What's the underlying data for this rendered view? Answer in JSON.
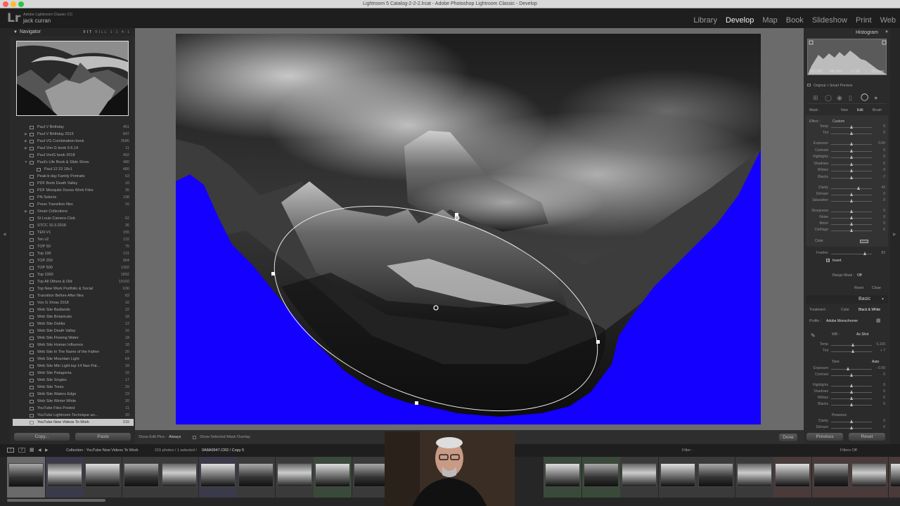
{
  "window": {
    "title": "Lightroom 5 Catalog-2-2-2.lrcat - Adobe Photoshop Lightroom Classic - Develop"
  },
  "identity": {
    "logo": "Lr",
    "app_name": "Adobe Lightroom Classic CC",
    "user": "jack curran"
  },
  "modules": [
    "Library",
    "Develop",
    "Map",
    "Book",
    "Slideshow",
    "Print",
    "Web"
  ],
  "navigator": {
    "title": "Navigator",
    "zoom_options": [
      "FIT",
      "FILL",
      "1:1",
      "4:1"
    ]
  },
  "collections": [
    {
      "name": "Paul V Birthday",
      "count": "451",
      "icon": "collection"
    },
    {
      "name": "Paul V Birthday 2015",
      "count": "847",
      "icon": "collection",
      "expand": "right"
    },
    {
      "name": "Paul VG Combination book",
      "count": "3586",
      "icon": "collection",
      "expand": "right"
    },
    {
      "name": "Paul Von G book 9.6.14",
      "count": "11",
      "icon": "collection",
      "expand": "right"
    },
    {
      "name": "Paul VonG book 2018",
      "count": "402",
      "icon": "collection"
    },
    {
      "name": "Paul's Life Book & Slide Show",
      "count": "480",
      "icon": "collection",
      "expand": "down"
    },
    {
      "name": "Paul 12 23 18v1",
      "count": "480",
      "icon": "book",
      "indent": true
    },
    {
      "name": "Peak-b day Family Portraits",
      "count": "63",
      "icon": "collection"
    },
    {
      "name": "PDF Book Death Valley",
      "count": "16",
      "icon": "collection"
    },
    {
      "name": "PDF Mesquite Dunes Work Files",
      "count": "35",
      "icon": "collection"
    },
    {
      "name": "PN Selects",
      "count": "108",
      "icon": "collection"
    },
    {
      "name": "Press Transition files",
      "count": "16",
      "icon": "collection"
    },
    {
      "name": "Smart Collections",
      "count": "",
      "icon": "folder",
      "expand": "right"
    },
    {
      "name": "St Louis Camera Club",
      "count": "62",
      "icon": "collection"
    },
    {
      "name": "STCC 10.3.2018",
      "count": "36",
      "icon": "collection"
    },
    {
      "name": "TEN V1",
      "count": "155",
      "icon": "collection"
    },
    {
      "name": "Ten v2",
      "count": "132",
      "icon": "collection"
    },
    {
      "name": "TOP 50",
      "count": "75",
      "icon": "collection"
    },
    {
      "name": "Top 100",
      "count": "131",
      "icon": "collection"
    },
    {
      "name": "TOP 250",
      "count": "964",
      "icon": "collection"
    },
    {
      "name": "TOP 500",
      "count": "1302",
      "icon": "collection"
    },
    {
      "name": "Top 1000",
      "count": "1892",
      "icon": "collection"
    },
    {
      "name": "Top All Others & Old",
      "count": "10150",
      "icon": "collection"
    },
    {
      "name": "Top New Work Portfolio & Social",
      "count": "636",
      "icon": "collection"
    },
    {
      "name": "Transition Before After files",
      "count": "83",
      "icon": "collection"
    },
    {
      "name": "Von G Xmas 2018",
      "count": "16",
      "icon": "collection"
    },
    {
      "name": "Web Site Badlands",
      "count": "22",
      "icon": "collection"
    },
    {
      "name": "Web Site Botanicals",
      "count": "18",
      "icon": "collection"
    },
    {
      "name": "Web Site Dahlia",
      "count": "12",
      "icon": "collection"
    },
    {
      "name": "Web Site Death Valley",
      "count": "16",
      "icon": "collection"
    },
    {
      "name": "Web Site Flowing Water",
      "count": "18",
      "icon": "collection"
    },
    {
      "name": "Web Site Human Influence",
      "count": "18",
      "icon": "collection"
    },
    {
      "name": "Web Site In The Name of the Father",
      "count": "20",
      "icon": "collection"
    },
    {
      "name": "Web Site Mountain Light",
      "count": "64",
      "icon": "collection"
    },
    {
      "name": "Web Site Mtn Light top 14 Nan Pat...",
      "count": "18",
      "icon": "collection"
    },
    {
      "name": "Web Site Patagonia",
      "count": "16",
      "icon": "collection"
    },
    {
      "name": "Web Site Singles",
      "count": "17",
      "icon": "collection"
    },
    {
      "name": "Web Site Trees",
      "count": "29",
      "icon": "collection"
    },
    {
      "name": "Web Site Waters Edge",
      "count": "23",
      "icon": "collection"
    },
    {
      "name": "Web Site Winter White",
      "count": "20",
      "icon": "collection"
    },
    {
      "name": "YouTube Files Posted",
      "count": "11",
      "icon": "collection"
    },
    {
      "name": "YouTube Lightroom Technique an...",
      "count": "20",
      "icon": "collection"
    },
    {
      "name": "YouTube New Videos To Work",
      "count": "215",
      "icon": "collection",
      "selected": true
    }
  ],
  "left_buttons": {
    "copy": "Copy...",
    "paste": "Paste"
  },
  "toolbar": {
    "show_edit_pins_label": "Show Edit Pins :",
    "show_edit_pins_value": "Always",
    "show_mask_overlay": "Show Selected Mask Overlay",
    "done": "Done"
  },
  "histogram": {
    "title": "Histogram",
    "iso": "ISO 100",
    "focal": "140 mm",
    "aperture": "ƒ / 16",
    "shutter": "25.0 sec",
    "preview": "Original + Smart Preview"
  },
  "mask": {
    "label": "Mask :",
    "new": "New",
    "edit": "Edit",
    "brush": "Brush"
  },
  "effect": {
    "label": "Effect :",
    "value": "Custom"
  },
  "sliders": [
    {
      "label": "Temp",
      "pos": 0.5,
      "value": "0"
    },
    {
      "label": "Tint",
      "pos": 0.5,
      "value": "0"
    },
    {
      "label": "Exposure",
      "pos": 0.5,
      "value": "0.00"
    },
    {
      "label": "Contrast",
      "pos": 0.5,
      "value": "0"
    },
    {
      "label": "Highlights",
      "pos": 0.5,
      "value": "0"
    },
    {
      "label": "Shadows",
      "pos": 0.5,
      "value": "0"
    },
    {
      "label": "Whites",
      "pos": 0.5,
      "value": "0"
    },
    {
      "label": "Blacks",
      "pos": 0.5,
      "value": "-7"
    },
    {
      "label": "Clarity",
      "pos": 0.68,
      "value": "43"
    },
    {
      "label": "Dehaze",
      "pos": 0.5,
      "value": "0"
    },
    {
      "label": "Saturation",
      "pos": 0.5,
      "value": "0"
    },
    {
      "label": "Sharpness",
      "pos": 0.5,
      "value": "0"
    },
    {
      "label": "Noise",
      "pos": 0.5,
      "value": "0"
    },
    {
      "label": "Moiré",
      "pos": 0.5,
      "value": "0"
    },
    {
      "label": "Defringe",
      "pos": 0.5,
      "value": "0"
    }
  ],
  "color_label": "Color",
  "feather": {
    "label": "Feather",
    "pos": 0.83,
    "value": "83"
  },
  "invert": "Invert",
  "range_mask": {
    "label": "Range Mask :",
    "value": "Off"
  },
  "mask_buttons": {
    "reset": "Reset",
    "close": "Close"
  },
  "basic": {
    "title": "Basic",
    "treatment_label": "Treatment :",
    "treatment_color": "Color",
    "treatment_bw": "Black & White",
    "profile_label": "Profile :",
    "profile_value": "Adobe Monochrome",
    "wb_label": "WB :",
    "wb_value": "As Shot",
    "tone_label": "Tone",
    "tone_auto": "Auto",
    "presence_label": "Presence",
    "sliders": [
      {
        "label": "Temp",
        "pos": 0.55,
        "value": "6,100"
      },
      {
        "label": "Tint",
        "pos": 0.55,
        "value": "+ 7"
      },
      {
        "label": "Exposure",
        "pos": 0.43,
        "value": "- 0.90"
      },
      {
        "label": "Contrast",
        "pos": 0.5,
        "value": "0"
      },
      {
        "label": "Highlights",
        "pos": 0.5,
        "value": "0"
      },
      {
        "label": "Shadows",
        "pos": 0.5,
        "value": "0"
      },
      {
        "label": "Whites",
        "pos": 0.5,
        "value": "0"
      },
      {
        "label": "Blacks",
        "pos": 0.5,
        "value": "0"
      },
      {
        "label": "Clarity",
        "pos": 0.5,
        "value": "0"
      },
      {
        "label": "Dehaze",
        "pos": 0.5,
        "value": "0"
      }
    ]
  },
  "nav_buttons": {
    "previous": "Previous",
    "reset": "Reset"
  },
  "filmstrip_bar": {
    "screens": [
      "1",
      "2"
    ],
    "source": "Collection : YouTube New Videos To Work",
    "count": "215 photos / 1 selected /",
    "file": "0A8A0947.CR2 / Copy 5",
    "filter_label": "Filter :",
    "filter_value": "Filters Off"
  },
  "colors": {
    "mask_overlay": "#1400ff",
    "panel": "#2b2b2b",
    "selected_row": "#c9c9c9"
  }
}
